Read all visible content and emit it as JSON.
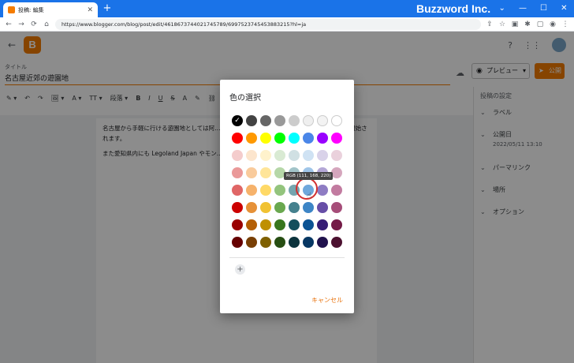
{
  "browser": {
    "tab_title": "投稿: 編集",
    "tab_close": "✕",
    "new_tab": "+",
    "brand": "Buzzword Inc.",
    "window_controls": [
      "⌄",
      "—",
      "☐",
      "✕"
    ],
    "url": "https://www.blogger.com/blog/post/edit/4618673744021745789/6997523745453883215?hl=ja",
    "nav_icons": {
      "back": "←",
      "forward": "→",
      "reload": "⟳",
      "home": "⌂",
      "lock": "🔒"
    },
    "addr_icons": [
      "⇪",
      "☆",
      "▣",
      "✱",
      "▢",
      "◉",
      "⋮"
    ]
  },
  "app": {
    "back_icon": "←",
    "logo_letter": "B",
    "help_icon": "?",
    "apps_icon": "⋮⋮",
    "title_label": "タイトル",
    "title_value": "名古屋近郊の遊園地",
    "cloud_icon": "☁",
    "preview_label": "プレビュー",
    "preview_caret": "▾",
    "publish_label": "公開",
    "publish_icon": "➤",
    "toolbar": [
      "✎ ▾",
      "↶",
      "↷",
      "🖼 ▾",
      "A ▾",
      "TT ▾",
      "段落 ▾",
      "B",
      "I",
      "U",
      "S",
      "A",
      "✎",
      "⛓",
      "⋯"
    ],
    "doc_paragraphs": [
      "名古屋から手軽に行ける遊園地としては阿…ます。数多くのジェットコースターに加えて…も開始されます。",
      "また愛知県内にも Legoland Japan やモン…"
    ],
    "sidebar": {
      "heading": "投稿の設定",
      "items": [
        {
          "label": "ラベル",
          "sub": ""
        },
        {
          "label": "公開日",
          "sub": "2022/05/11 13:10"
        },
        {
          "label": "パーマリンク",
          "sub": ""
        },
        {
          "label": "場所",
          "sub": ""
        },
        {
          "label": "オプション",
          "sub": ""
        }
      ],
      "chevron": "⌄"
    }
  },
  "dialog": {
    "title": "色の選択",
    "tooltip": "RGB (111, 168, 220)",
    "add_custom": "+",
    "cancel_label": "キャンセル",
    "selected_color": "#000000",
    "hovered_color": "#6fa8dc",
    "palette": [
      [
        "#000000",
        "#434343",
        "#666666",
        "#999999",
        "#cccccc",
        "#efefef",
        "#f3f3f3",
        "#ffffff"
      ],
      [
        "#ff0000",
        "#ff9900",
        "#ffff00",
        "#00ff00",
        "#00ffff",
        "#4a86e8",
        "#9900ff",
        "#ff00ff"
      ],
      [
        "#f4cccc",
        "#fce5cd",
        "#fff2cc",
        "#d9ead3",
        "#d0e0e3",
        "#cfe2f3",
        "#d9d2e9",
        "#ead1dc"
      ],
      [
        "#ea9999",
        "#f9cb9c",
        "#ffe599",
        "#b6d7a8",
        "#a2c4c9",
        "#9fc5e8",
        "#b4a7d6",
        "#d5a6bd"
      ],
      [
        "#e06666",
        "#f6b26b",
        "#ffd966",
        "#93c47d",
        "#76a5af",
        "#6fa8dc",
        "#8e7cc3",
        "#c27ba0"
      ],
      [
        "#cc0000",
        "#e69138",
        "#f1c232",
        "#6aa84f",
        "#45818e",
        "#3d85c6",
        "#674ea7",
        "#a64d79"
      ],
      [
        "#990000",
        "#b45f06",
        "#bf9000",
        "#38761d",
        "#134f5c",
        "#0b5394",
        "#351c75",
        "#741b47"
      ],
      [
        "#660000",
        "#783f04",
        "#7f6000",
        "#274e13",
        "#0c343d",
        "#073763",
        "#20124d",
        "#4c1130"
      ]
    ]
  }
}
